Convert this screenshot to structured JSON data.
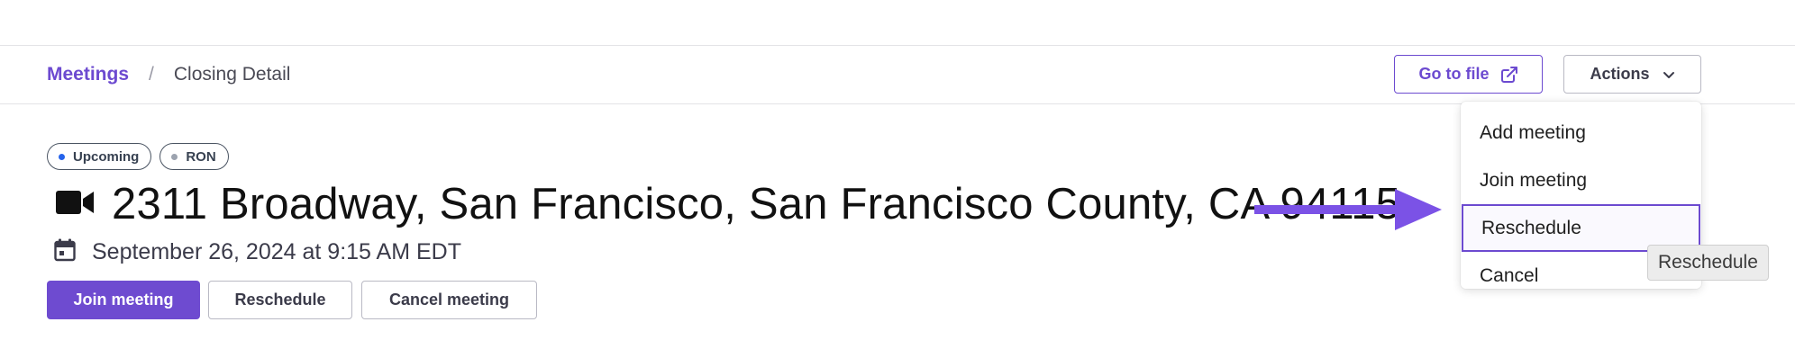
{
  "breadcrumb": {
    "root": "Meetings",
    "separator": "/",
    "current": "Closing Detail"
  },
  "header": {
    "go_to_file_label": "Go to file",
    "go_to_file_icon": "external-link-icon",
    "actions_label": "Actions",
    "actions_icon": "chevron-down-icon"
  },
  "actions_menu": {
    "items": [
      {
        "label": "Add meeting"
      },
      {
        "label": "Join meeting"
      },
      {
        "label": "Reschedule",
        "active": true
      },
      {
        "label": "Cancel"
      }
    ]
  },
  "tooltip": {
    "text": "Reschedule"
  },
  "meeting": {
    "badges": [
      {
        "label": "Upcoming",
        "dot_color": "#2563eb"
      },
      {
        "label": "RON",
        "dot_color": "#9ca3af"
      }
    ],
    "type_icon": "video-camera-icon",
    "title": "2311 Broadway, San Francisco, San Francisco County, CA 94115",
    "date_icon": "calendar-icon",
    "datetime": "September 26, 2024 at 9:15 AM EDT"
  },
  "buttons": {
    "join": "Join meeting",
    "reschedule": "Reschedule",
    "cancel": "Cancel meeting"
  },
  "colors": {
    "accent": "#6c4ad0",
    "annotation_arrow": "#7b52e6"
  }
}
